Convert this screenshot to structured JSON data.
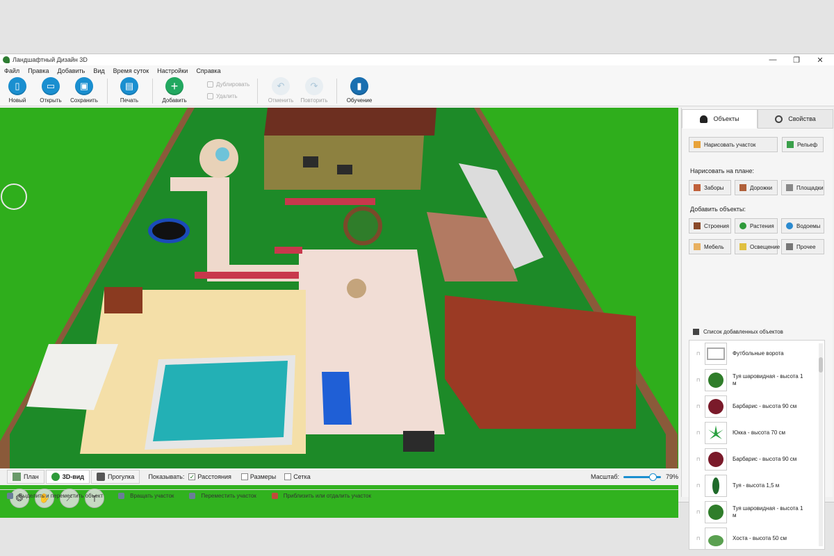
{
  "app": {
    "title": "Ландшафтный Дизайн 3D"
  },
  "window_controls": [
    "—",
    "❐",
    "✕"
  ],
  "menu": [
    "Файл",
    "Правка",
    "Добавить",
    "Вид",
    "Время суток",
    "Настройки",
    "Справка"
  ],
  "toolbar": {
    "new": "Новый",
    "open": "Открыть",
    "save": "Сохранить",
    "print": "Печать",
    "add": "Добавить",
    "duplicate": "Дублировать",
    "delete": "Удалить",
    "undo": "Отменить",
    "redo": "Повторить",
    "tutorial": "Обучение"
  },
  "views": {
    "plan": "План",
    "view3d": "3D-вид",
    "walk": "Прогулка"
  },
  "show": {
    "label": "Показывать:",
    "distances": {
      "label": "Расстояния",
      "checked": true
    },
    "sizes": {
      "label": "Размеры",
      "checked": false
    },
    "grid": {
      "label": "Сетка",
      "checked": false
    }
  },
  "scale": {
    "label": "Масштаб:",
    "value": "79%",
    "fraction": 0.79
  },
  "hints": [
    "Выделить и переместить объект",
    "Вращать участок",
    "Переместить участок",
    "Приблизить или отдалить участок"
  ],
  "panel": {
    "tabs": {
      "objects": "Объекты",
      "properties": "Свойства"
    },
    "draw_plot": "Нарисовать участок",
    "relief": "Рельеф",
    "draw_on_plan": "Нарисовать на плане:",
    "fences": "Заборы",
    "paths": "Дорожки",
    "platforms": "Площадки",
    "add_objects": "Добавить объекты:",
    "buildings": "Строения",
    "plants": "Растения",
    "ponds": "Водоемы",
    "furniture": "Мебель",
    "lighting": "Освещение",
    "other": "Прочее",
    "list_title": "Список добавленных объектов",
    "items": [
      {
        "name": "Футбольные ворота",
        "icon": "goal-icon"
      },
      {
        "name": "Туя шаровидная - высота 1 м",
        "icon": "shrub-icon"
      },
      {
        "name": "Барбарис - высота 90 см",
        "icon": "barberry-icon"
      },
      {
        "name": "Юкка - высота 70 см",
        "icon": "yucca-icon"
      },
      {
        "name": "Барбарис - высота 90 см",
        "icon": "barberry-icon"
      },
      {
        "name": "Туя - высота 1,5 м",
        "icon": "thuja-icon"
      },
      {
        "name": "Туя шаровидная - высота 1 м",
        "icon": "shrub-icon"
      },
      {
        "name": "Хоста - высота 50 см",
        "icon": "hosta-icon"
      }
    ]
  },
  "colors": {
    "accent": "#1a8fd0",
    "grass": "#31b21f",
    "roof": "#9b3a24",
    "pool": "#23b0b5"
  }
}
